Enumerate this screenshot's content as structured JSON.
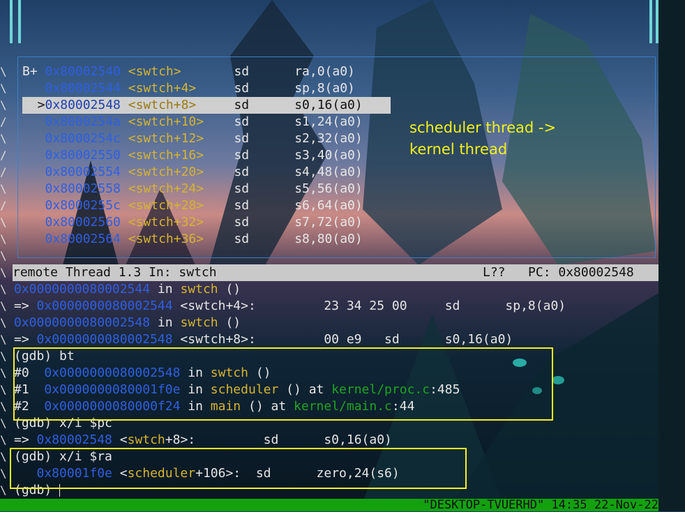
{
  "asm": [
    {
      "marker": "B+ ",
      "addr": "0x80002540",
      "sym": "<swtch>    ",
      "op": "sd",
      "args": "ra,0(a0)",
      "hl": false
    },
    {
      "marker": "   ",
      "addr": "0x80002544",
      "sym": "<swtch+4>  ",
      "op": "sd",
      "args": "sp,8(a0)",
      "hl": false
    },
    {
      "marker": "  >",
      "addr": "0x80002548",
      "sym": "<swtch+8>  ",
      "op": "sd",
      "args": "s0,16(a0)",
      "hl": true
    },
    {
      "marker": "   ",
      "addr": "0x8000254a",
      "sym": "<swtch+10> ",
      "op": "sd",
      "args": "s1,24(a0)",
      "hl": false
    },
    {
      "marker": "   ",
      "addr": "0x8000254c",
      "sym": "<swtch+12> ",
      "op": "sd",
      "args": "s2,32(a0)",
      "hl": false
    },
    {
      "marker": "   ",
      "addr": "0x80002550",
      "sym": "<swtch+16> ",
      "op": "sd",
      "args": "s3,40(a0)",
      "hl": false
    },
    {
      "marker": "   ",
      "addr": "0x80002554",
      "sym": "<swtch+20> ",
      "op": "sd",
      "args": "s4,48(a0)",
      "hl": false
    },
    {
      "marker": "   ",
      "addr": "0x80002558",
      "sym": "<swtch+24> ",
      "op": "sd",
      "args": "s5,56(a0)",
      "hl": false
    },
    {
      "marker": "   ",
      "addr": "0x8000255c",
      "sym": "<swtch+28> ",
      "op": "sd",
      "args": "s6,64(a0)",
      "hl": false
    },
    {
      "marker": "   ",
      "addr": "0x80002560",
      "sym": "<swtch+32> ",
      "op": "sd",
      "args": "s7,72(a0)",
      "hl": false
    },
    {
      "marker": "   ",
      "addr": "0x80002564",
      "sym": "<swtch+36> ",
      "op": "sd",
      "args": "s8,80(a0)",
      "hl": false
    }
  ],
  "note": {
    "line1": "scheduler thread ->",
    "line2": "kernel thread"
  },
  "status": {
    "left": "remote Thread 1.3 In: swtch",
    "right": "L??   PC: 0x80002548"
  },
  "cmd": {
    "l1a": "0x0000000080002544",
    "l1b": " in ",
    "l1c": "swtch",
    "l1d": " ()",
    "l2a": "=> ",
    "l2b": "0x0000000080002544",
    "l2c": " <swtch+4>:         23 34 25 00     sd      sp,8(a0)",
    "l3a": "0x0000000080002548",
    "l3b": " in ",
    "l3c": "swtch",
    "l3d": " ()",
    "l4a": "=> ",
    "l4b": "0x0000000080002548",
    "l4c": " <swtch+8>:         00 e9   sd      s0,16(a0)",
    "bt": "(gdb) bt",
    "f0a": "#0  ",
    "f0b": "0x0000000080002548",
    "f0c": " in ",
    "f0d": "swtch",
    "f0e": " ()",
    "f1a": "#1  ",
    "f1b": "0x0000000080001f0e",
    "f1c": " in ",
    "f1d": "scheduler",
    "f1e": " () at ",
    "f1f": "kernel/proc.c",
    "f1g": ":485",
    "f2a": "#2  ",
    "f2b": "0x0000000080000f24",
    "f2c": " in ",
    "f2d": "main",
    "f2e": " () at ",
    "f2f": "kernel/main.c",
    "f2g": ":44",
    "xpc": "(gdb) x/i $pc",
    "xpc_a": "=> ",
    "xpc_b": "0x80002548",
    "xpc_c": " <",
    "xpc_d": "swtch",
    "xpc_e": "+8>:         sd      s0,16(a0)",
    "xra": "(gdb) x/i $ra",
    "xra_b": "   0x80001f0e",
    "xra_c": " <",
    "xra_d": "scheduler",
    "xra_e": "+106>:  sd      zero,24(s6)",
    "prompt": "(gdb) "
  },
  "bottom_bar": "\"DESKTOP-TVUERHD\" 14:35 22-Nov-22",
  "gutter": [
    "\\",
    "\\",
    "\\",
    "/",
    "\\",
    "/",
    "/",
    "\\",
    "/",
    "\\",
    "\\",
    "\\",
    "\\",
    "\\",
    "\\",
    "\\",
    "\\",
    "\\",
    "\\",
    "\\",
    "\\",
    "\\",
    "\\",
    "\\",
    "\\",
    "\\"
  ],
  "colors": {
    "addr": "#2f5fe0",
    "sym": "#d6b430",
    "file": "#1fa51f",
    "highlight_box": "#f2f21a",
    "status_bg": "#c9c9c9",
    "bottom_bar": "#13a10e"
  }
}
